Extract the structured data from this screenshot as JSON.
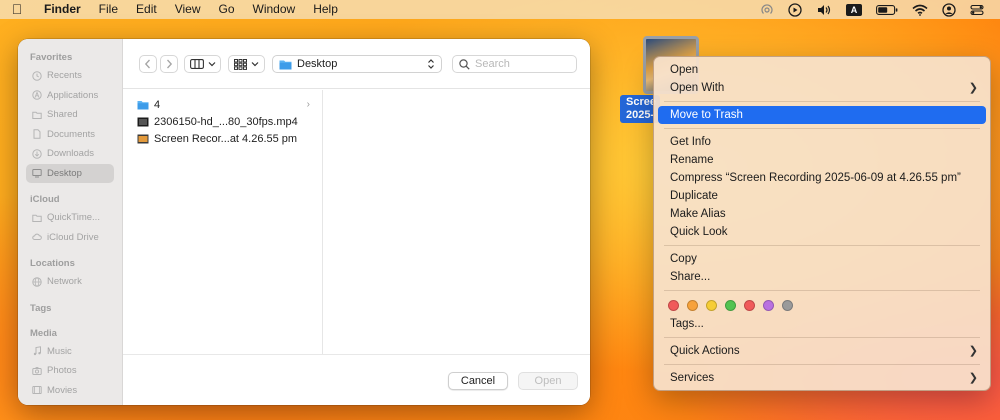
{
  "menubar": {
    "app_name": "Finder",
    "items": [
      "File",
      "Edit",
      "View",
      "Go",
      "Window",
      "Help"
    ],
    "input_source": "A"
  },
  "dialog": {
    "sidebar": {
      "favorites_heading": "Favorites",
      "favorites": [
        "Recents",
        "Applications",
        "Shared",
        "Documents",
        "Downloads",
        "Desktop"
      ],
      "icloud_heading": "iCloud",
      "icloud": [
        "QuickTime...",
        "iCloud Drive"
      ],
      "locations_heading": "Locations",
      "locations": [
        "Network"
      ],
      "tags_heading": "Tags",
      "media_heading": "Media",
      "media": [
        "Music",
        "Photos",
        "Movies"
      ]
    },
    "toolbar": {
      "location": "Desktop",
      "search_placeholder": "Search"
    },
    "files": [
      {
        "name": "4",
        "icon": "folder-icon",
        "has_children": true
      },
      {
        "name": "2306150-hd_...80_30fps.mp4",
        "icon": "video-file-icon",
        "has_children": false
      },
      {
        "name": "Screen Recor...at 4.26.55 pm",
        "icon": "screen-recording-icon",
        "has_children": false
      }
    ],
    "buttons": {
      "cancel": "Cancel",
      "open": "Open"
    }
  },
  "desktop": {
    "file_label_line1": "Scree",
    "file_label_line2": "2025-"
  },
  "context_menu": {
    "open": "Open",
    "open_with": "Open With",
    "move_to_trash": "Move to Trash",
    "get_info": "Get Info",
    "rename": "Rename",
    "compress": "Compress “Screen Recording 2025-06-09 at 4.26.55 pm”",
    "duplicate": "Duplicate",
    "make_alias": "Make Alias",
    "quick_look": "Quick Look",
    "copy": "Copy",
    "share": "Share...",
    "tag_colors": [
      "#f05a5a",
      "#f7a23b",
      "#f6cd36",
      "#53c351",
      "#f05a5a",
      "#b970e0",
      "#9a9a9a"
    ],
    "tags": "Tags...",
    "quick_actions": "Quick Actions",
    "services": "Services"
  }
}
